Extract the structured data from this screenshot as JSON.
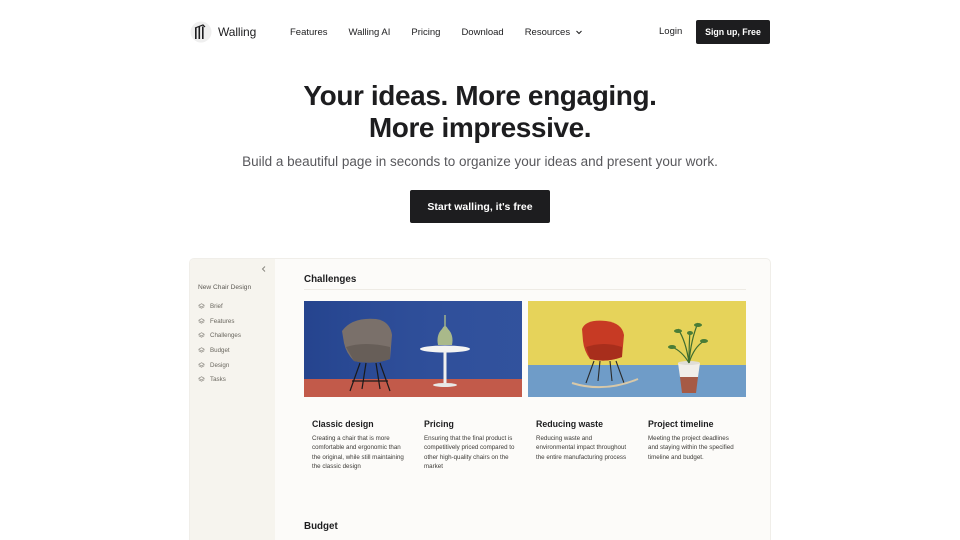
{
  "nav": {
    "brand": "Walling",
    "links": [
      {
        "label": "Features"
      },
      {
        "label": "Walling AI"
      },
      {
        "label": "Pricing"
      },
      {
        "label": "Download"
      },
      {
        "label": "Resources"
      }
    ],
    "login": "Login",
    "signup": "Sign up, Free"
  },
  "hero": {
    "title_line1": "Your ideas. More engaging.",
    "title_line2": "More impressive.",
    "subtitle": "Build a beautiful page in seconds to organize your ideas and present your work.",
    "cta": "Start walling, it's free"
  },
  "app": {
    "collapse_icon": "chevron-left-icon",
    "sidebar": {
      "title": "New Chair Design",
      "items": [
        {
          "label": "Brief"
        },
        {
          "label": "Features"
        },
        {
          "label": "Challenges"
        },
        {
          "label": "Budget"
        },
        {
          "label": "Design"
        },
        {
          "label": "Tasks"
        }
      ]
    },
    "section_title": "Challenges",
    "cards": [
      {
        "title": "Classic design",
        "desc": "Creating a chair that is more comfortable and ergonomic than the original, while still maintaining the classic design"
      },
      {
        "title": "Pricing",
        "desc": "Ensuring that the final product is competitively priced compared to other high-quality chairs on the market"
      },
      {
        "title": "Reducing waste",
        "desc": "Reducing waste and environmental impact throughout the entire manufacturing process"
      },
      {
        "title": "Project timeline",
        "desc": "Meeting the project deadlines and staying within the specified timeline and budget."
      }
    ],
    "next_section_title": "Budget"
  },
  "colors": {
    "primary": "#1d1d1f",
    "sidebar_bg": "#f6f4ee",
    "image1_bg_top": "#2f4f9a",
    "image1_bg_bottom": "#c25a4a",
    "image2_bg_top": "#e6d35a",
    "image2_bg_bottom": "#6f9cc8"
  }
}
